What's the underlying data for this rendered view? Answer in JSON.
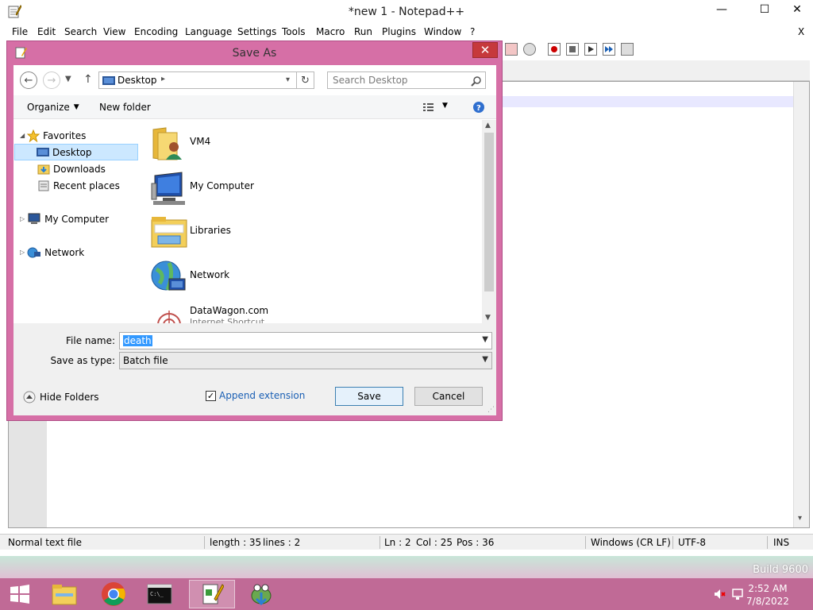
{
  "app": {
    "title": "*new 1 - Notepad++",
    "window_controls": {
      "minimize": "—",
      "maximize": "☐",
      "close": "✕"
    },
    "menu_close": "X",
    "menu": [
      "File",
      "Edit",
      "Search",
      "View",
      "Encoding",
      "Language",
      "Settings",
      "Tools",
      "Macro",
      "Run",
      "Plugins",
      "Window",
      "?"
    ]
  },
  "statusbar": {
    "file_type": "Normal text file",
    "length": "length : 35",
    "lines": "lines : 2",
    "ln": "Ln : 2",
    "col": "Col : 25",
    "pos": "Pos : 36",
    "eol": "Windows (CR LF)",
    "encoding": "UTF-8",
    "mode": "INS"
  },
  "dialog": {
    "title": "Save As",
    "close": "✕",
    "address": "Desktop",
    "search_placeholder": "Search Desktop",
    "organize": "Organize",
    "new_folder": "New folder",
    "tree": {
      "favorites": "Favorites",
      "desktop": "Desktop",
      "downloads": "Downloads",
      "recent": "Recent places",
      "computer": "My Computer",
      "network": "Network"
    },
    "files": [
      {
        "name": "VM4",
        "icon": "user-folder-icon"
      },
      {
        "name": "My Computer",
        "icon": "computer-icon"
      },
      {
        "name": "Libraries",
        "icon": "libraries-folder-icon"
      },
      {
        "name": "Network",
        "icon": "network-globe-icon"
      },
      {
        "name": "DataWagon.com",
        "sub": "Internet Shortcut",
        "icon": "internet-shortcut-icon"
      }
    ],
    "file_name_label": "File name:",
    "file_name_value": "death",
    "save_as_type_label": "Save as type:",
    "save_as_type_value": "Batch file",
    "hide_folders": "Hide Folders",
    "append_extension": "Append extension",
    "save": "Save",
    "cancel": "Cancel"
  },
  "desktop": {
    "build": "Build 9600"
  },
  "taskbar": {
    "time": "2:52 AM",
    "date": "7/8/2022"
  },
  "colors": {
    "dialog_frame": "#d66fa6",
    "taskbar": "#c06a96",
    "close_red": "#c6393c",
    "selection": "#cce8ff"
  }
}
